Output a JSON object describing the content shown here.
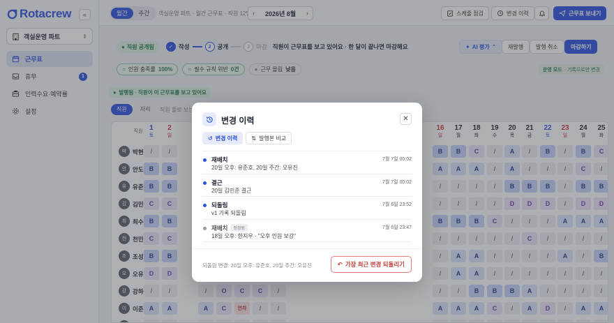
{
  "brand": {
    "name": "Rotacrew",
    "color": "#2d52e0"
  },
  "sidebar": {
    "team": "객실운영 파트",
    "items": [
      {
        "label": "근무표",
        "icon": "calendar-icon",
        "active": true
      },
      {
        "label": "휴무",
        "icon": "inbox-icon",
        "badge": "1"
      },
      {
        "label": "인력수요·예약률",
        "icon": "chart-icon"
      },
      {
        "label": "설정",
        "icon": "gear-icon"
      }
    ]
  },
  "topbar": {
    "view_month": "월간",
    "view_week": "주간",
    "breadcrumb": "객실운영 파트 · 월간 근무표 · 직원 12명",
    "month": "2026년 8월",
    "check_schedule": "스케줄 점검",
    "history": "변경 이력",
    "send": "근무표 보내기"
  },
  "status": {
    "published_pill": "직원 공개됨",
    "step1": "작성",
    "step2": "공개",
    "step3": "마감",
    "step3_num": "3",
    "step2_num": "2",
    "message": "직원이 근무표를 보고 있어요 · 한 달이 끝나면 마감해요",
    "ai": "AI 평가",
    "republish": "재발행",
    "unpublish": "발행 취소",
    "close": "마감하기"
  },
  "metrics": {
    "staffing_label": "인원 충족률",
    "staffing_value": "100%",
    "violations_label": "필수 규칙 위반",
    "violations_value": "0건",
    "fatigue_label": "근무 몰림",
    "fatigue_value": "낮음"
  },
  "mode": {
    "label": "운영 모드",
    "desc": "· 기록으로만 변경"
  },
  "published_banner": "발행됨 · 직원이 이 근무표를 보고 있어요",
  "grid_tabs": {
    "staff": "직원",
    "seat": "자리",
    "hint": "직원 줄로 보는"
  },
  "grid": {
    "name_header": "직원",
    "left_days": [
      {
        "num": "1",
        "dow": "토",
        "color": "#2d52e0"
      },
      {
        "num": "2",
        "dow": "일",
        "color": "#d0343f"
      }
    ],
    "right_days": [
      {
        "num": "16",
        "dow": "일",
        "color": "#d0343f"
      },
      {
        "num": "17",
        "dow": "월",
        "color": "#1f2430"
      },
      {
        "num": "18",
        "dow": "화",
        "color": "#1f2430"
      },
      {
        "num": "19",
        "dow": "수",
        "color": "#1f2430"
      },
      {
        "num": "20",
        "dow": "목",
        "color": "#1f2430"
      },
      {
        "num": "21",
        "dow": "금",
        "color": "#1f2430"
      },
      {
        "num": "22",
        "dow": "토",
        "color": "#2d52e0"
      },
      {
        "num": "23",
        "dow": "일",
        "color": "#d0343f"
      },
      {
        "num": "24",
        "dow": "월",
        "color": "#1f2430"
      },
      {
        "num": "25",
        "dow": "화",
        "color": "#1f2430"
      }
    ],
    "rows": [
      {
        "name": "박현우",
        "avatar": "박",
        "left": [
          "/",
          "/"
        ],
        "mid": [],
        "right": [
          "B",
          "B",
          "C",
          "/",
          "A",
          "/",
          "B",
          "/",
          "B",
          "C"
        ]
      },
      {
        "name": "안도윤",
        "avatar": "안",
        "left": [
          "B",
          "B"
        ],
        "mid": [],
        "right": [
          "A",
          "A",
          "A",
          "/",
          "A",
          "/",
          "/",
          "/",
          "C",
          "/"
        ]
      },
      {
        "name": "유준호",
        "avatar": "유",
        "left": [
          "B",
          "B"
        ],
        "mid": [],
        "right": [
          "/",
          "/",
          "/",
          "/",
          "B",
          "B",
          "B",
          "/",
          "B",
          "B"
        ]
      },
      {
        "name": "김민준",
        "avatar": "김",
        "left": [
          "C",
          "C"
        ],
        "mid": [],
        "right": [
          "/",
          "/",
          "/",
          "/",
          "D",
          "D",
          "D",
          "/",
          "D",
          "D"
        ]
      },
      {
        "name": "최수아",
        "avatar": "최",
        "left": [
          "B",
          "B"
        ],
        "mid": [],
        "right": [
          "B",
          "B",
          "B",
          "C",
          "/",
          "/",
          "/",
          "A",
          "A",
          "A"
        ]
      },
      {
        "name": "천민재",
        "avatar": "천",
        "left": [
          "C",
          "C"
        ],
        "mid": [],
        "right": [
          "/",
          "/",
          "/",
          "/",
          "/",
          "C",
          "/",
          "/",
          "/",
          "/"
        ]
      },
      {
        "name": "조성민",
        "avatar": "조",
        "left": [
          "B",
          "B"
        ],
        "mid": [],
        "right": [
          "/",
          "A",
          "A",
          "/",
          "/",
          "/",
          "/",
          "A",
          "/",
          "B"
        ]
      },
      {
        "name": "오유진",
        "avatar": "오",
        "left": [
          "D",
          "D"
        ],
        "mid": [],
        "right": [
          "/",
          "A",
          "A",
          "/",
          "/",
          "/",
          "/",
          "/",
          "/",
          "/"
        ]
      },
      {
        "name": "강하윤",
        "avatar": "강",
        "left": [
          "/",
          "/"
        ],
        "mid": [
          "/",
          "O",
          "C",
          "C",
          "/"
        ],
        "right": [
          "/",
          "/",
          "B",
          "B",
          "B",
          "A",
          "/",
          "/",
          "/",
          "/"
        ]
      },
      {
        "name": "이준서",
        "avatar": "이",
        "left": [
          "A",
          "A"
        ],
        "mid": [
          "A",
          "C",
          "연차",
          "/",
          "/"
        ],
        "right": [
          "A",
          "A",
          "A",
          "C",
          "/",
          "A",
          "D",
          "/",
          "A",
          "A"
        ]
      },
      {
        "name": "이서연",
        "avatar": "이",
        "left": [
          "/",
          "/"
        ],
        "mid": [
          "/",
          "/",
          "/",
          "/",
          "/"
        ],
        "right": [
          "/",
          "/",
          "/",
          "/",
          "/",
          "/",
          "/",
          "/",
          "/",
          "/"
        ]
      }
    ]
  },
  "modal": {
    "title": "변경 이력",
    "tab_history": "변경 이력",
    "tab_compare": "발행본 비교",
    "items": [
      {
        "action": "재배치",
        "detail": "20일 오후: 유준호, 20일 주간: 오유진",
        "time": "7월 7일 00:02",
        "tag": ""
      },
      {
        "action": "결근",
        "detail": "20일 김민준 결근",
        "time": "7월 7일 00:02",
        "tag": ""
      },
      {
        "action": "되돌림",
        "detail": "v1 기록 되돌림",
        "time": "7월 6일 23:52",
        "tag": ""
      },
      {
        "action": "재배치",
        "detail": "18일 오후: 한지우 · \"오후 인원 보강\"",
        "time": "7월 6일 23:47",
        "tag": "정정됨"
      }
    ],
    "footer_note": "되돌림 변경: 20일 오후: 유준호, 20일 주간: 오유진",
    "revert": "가장 최근 변경 되돌리기"
  }
}
